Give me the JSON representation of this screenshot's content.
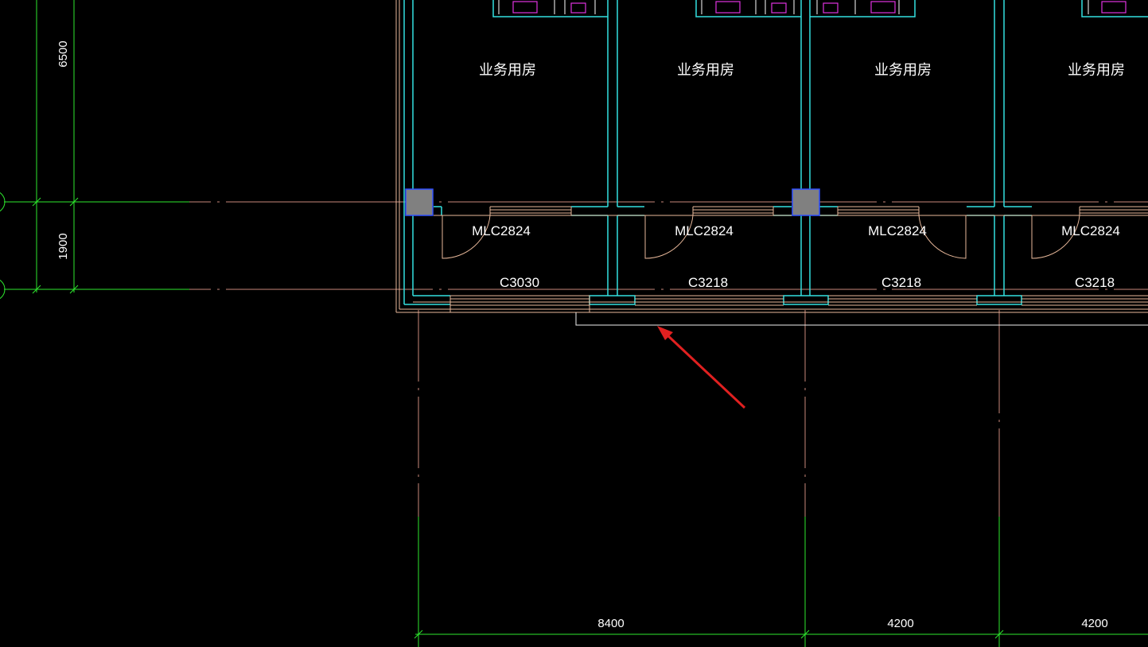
{
  "colors": {
    "background": "#000000",
    "axis_line": "#c8877a",
    "wall": "#33e0e0",
    "dimension": "#2ee82e",
    "window": "#e8b89a",
    "furniture": "#e032e0",
    "column": "#808080",
    "column_border": "#3050ff",
    "annotation_arrow": "#e02020",
    "slab_edge": "#f0f0f0",
    "text": "#ffffff"
  },
  "dimensions": {
    "vertical": [
      "6500",
      "1900"
    ],
    "horizontal": [
      "8400",
      "4200",
      "4200"
    ]
  },
  "rooms": [
    {
      "name": "业务用房",
      "door": "MLC2824",
      "window": "C3030"
    },
    {
      "name": "业务用房",
      "door": "MLC2824",
      "window": "C3218"
    },
    {
      "name": "业务用房",
      "door": "MLC2824",
      "window": "C3218"
    },
    {
      "name": "业务用房",
      "door": "MLC2824",
      "window": "C3218"
    }
  ],
  "annotation": {
    "icon": "red-arrow-icon"
  }
}
